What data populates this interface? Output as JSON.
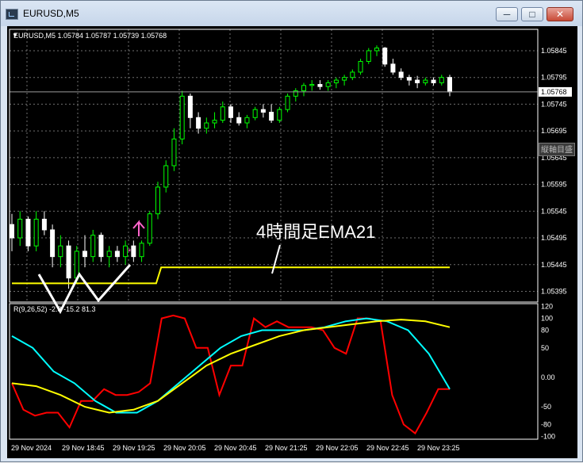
{
  "window": {
    "title": "EURUSD,M5",
    "minimize_icon": "minimize-icon",
    "maximize_icon": "maximize-icon",
    "close_icon": "close-icon"
  },
  "chart": {
    "symbol_info": "EURUSD,M5  1.05784 1.05787 1.05739 1.05768",
    "current_price": "1.05768",
    "price_axis": [
      "1.05845",
      "1.05795",
      "1.05745",
      "1.05695",
      "1.05645",
      "1.05595",
      "1.05545",
      "1.05495",
      "1.05445",
      "1.05395"
    ],
    "annotation": "4時間足EMA21",
    "crosshair_button": "縦軸目盛",
    "colors": {
      "background": "#000000",
      "bull": "#00ff00",
      "bear": "#ffffff",
      "ema": "#ffff00"
    }
  },
  "indicator": {
    "label": "R(9,26,52) -2.8 -15.2 81.3",
    "axis": [
      "120",
      "100",
      "80",
      "50",
      "0.00",
      "-50",
      "-80",
      "-100"
    ],
    "colors": {
      "fast": "#ff0000",
      "mid": "#00ffff",
      "slow": "#ffff00"
    }
  },
  "time_axis": [
    "29 Nov 2024",
    "29 Nov 18:45",
    "29 Nov 19:25",
    "29 Nov 20:05",
    "29 Nov 20:45",
    "29 Nov 21:25",
    "29 Nov 22:05",
    "29 Nov 22:45",
    "29 Nov 23:25"
  ],
  "chart_data": {
    "type": "candlestick",
    "title": "EURUSD,M5",
    "ylim": [
      1.05375,
      1.05885
    ],
    "candles": [
      [
        1.0552,
        1.0554,
        1.0547,
        1.05495
      ],
      [
        1.05495,
        1.05545,
        1.0548,
        1.0553
      ],
      [
        1.0553,
        1.05535,
        1.0547,
        1.0548
      ],
      [
        1.0548,
        1.05545,
        1.0547,
        1.0553
      ],
      [
        1.0553,
        1.05545,
        1.055,
        1.0551
      ],
      [
        1.0551,
        1.0552,
        1.0544,
        1.0546
      ],
      [
        1.0546,
        1.055,
        1.0544,
        1.0548
      ],
      [
        1.0548,
        1.0549,
        1.054,
        1.0542
      ],
      [
        1.0542,
        1.0548,
        1.0541,
        1.0547
      ],
      [
        1.0547,
        1.055,
        1.0544,
        1.0546
      ],
      [
        1.0546,
        1.0551,
        1.0545,
        1.055
      ],
      [
        1.055,
        1.05505,
        1.0545,
        1.0546
      ],
      [
        1.0546,
        1.0548,
        1.0544,
        1.0547
      ],
      [
        1.0547,
        1.0548,
        1.0545,
        1.0546
      ],
      [
        1.0546,
        1.0549,
        1.05445,
        1.0548
      ],
      [
        1.0548,
        1.0549,
        1.0545,
        1.0546
      ],
      [
        1.0546,
        1.0549,
        1.0545,
        1.05485
      ],
      [
        1.05485,
        1.05545,
        1.0548,
        1.0554
      ],
      [
        1.0554,
        1.056,
        1.0553,
        1.0559
      ],
      [
        1.0559,
        1.0564,
        1.0558,
        1.0563
      ],
      [
        1.0563,
        1.057,
        1.0562,
        1.0568
      ],
      [
        1.0568,
        1.0577,
        1.0567,
        1.0576
      ],
      [
        1.0576,
        1.05765,
        1.057,
        1.0572
      ],
      [
        1.0572,
        1.0573,
        1.0569,
        1.057
      ],
      [
        1.057,
        1.0572,
        1.0569,
        1.0571
      ],
      [
        1.0571,
        1.0573,
        1.057,
        1.05715
      ],
      [
        1.05715,
        1.0575,
        1.0571,
        1.0574
      ],
      [
        1.0574,
        1.05745,
        1.0571,
        1.0572
      ],
      [
        1.0572,
        1.0573,
        1.05705,
        1.0571
      ],
      [
        1.0571,
        1.05725,
        1.057,
        1.0572
      ],
      [
        1.0572,
        1.0574,
        1.05715,
        1.05735
      ],
      [
        1.05735,
        1.05745,
        1.0572,
        1.0573
      ],
      [
        1.0573,
        1.05745,
        1.0571,
        1.05715
      ],
      [
        1.05715,
        1.0574,
        1.0571,
        1.05735
      ],
      [
        1.05735,
        1.05765,
        1.0573,
        1.0576
      ],
      [
        1.0576,
        1.05775,
        1.0575,
        1.0577
      ],
      [
        1.0577,
        1.05785,
        1.0576,
        1.0578
      ],
      [
        1.0578,
        1.0579,
        1.0577,
        1.05782
      ],
      [
        1.05782,
        1.0579,
        1.05772,
        1.05778
      ],
      [
        1.05778,
        1.0579,
        1.0577,
        1.05785
      ],
      [
        1.05785,
        1.05795,
        1.05775,
        1.0579
      ],
      [
        1.0579,
        1.058,
        1.0578,
        1.05795
      ],
      [
        1.05795,
        1.0581,
        1.0579,
        1.05805
      ],
      [
        1.05805,
        1.0583,
        1.058,
        1.05825
      ],
      [
        1.05825,
        1.0585,
        1.0582,
        1.05845
      ],
      [
        1.05845,
        1.05855,
        1.05835,
        1.0585
      ],
      [
        1.0585,
        1.05852,
        1.05815,
        1.0582
      ],
      [
        1.0582,
        1.0583,
        1.058,
        1.05805
      ],
      [
        1.05805,
        1.05812,
        1.0579,
        1.05795
      ],
      [
        1.05795,
        1.058,
        1.0578,
        1.0579
      ],
      [
        1.0579,
        1.05798,
        1.05775,
        1.05785
      ],
      [
        1.05785,
        1.05795,
        1.0578,
        1.0579
      ],
      [
        1.0579,
        1.05795,
        1.0578,
        1.05785
      ],
      [
        1.05785,
        1.058,
        1.0578,
        1.05795
      ],
      [
        1.05795,
        1.058,
        1.0576,
        1.05768
      ]
    ],
    "ema_levels": [
      [
        0,
        1.0541
      ],
      [
        29,
        1.0541
      ],
      [
        30,
        1.0544
      ],
      [
        88,
        1.0544
      ]
    ],
    "indicator_series": [
      {
        "values": [
          -10,
          -55,
          -65,
          -60,
          -60,
          -85,
          -40,
          -40,
          -20,
          -30,
          -30,
          -25,
          -10,
          100,
          105,
          100,
          50,
          50,
          -30,
          20,
          20,
          100,
          85,
          95,
          85,
          85,
          85,
          80,
          50,
          40,
          100,
          100,
          95,
          -30,
          -80,
          -95,
          -60,
          -20,
          -20
        ]
      },
      {
        "values": [
          70,
          50,
          10,
          -10,
          -40,
          -60,
          -60,
          -40,
          -10,
          20,
          50,
          70,
          80,
          80,
          80,
          85,
          95,
          100,
          95,
          80,
          40,
          -20
        ]
      },
      {
        "values": [
          -10,
          -15,
          -30,
          -50,
          -60,
          -55,
          -40,
          -10,
          20,
          40,
          55,
          70,
          80,
          85,
          90,
          95,
          98,
          95,
          85
        ]
      }
    ],
    "indicator_ylim": [
      -105,
      125
    ]
  }
}
